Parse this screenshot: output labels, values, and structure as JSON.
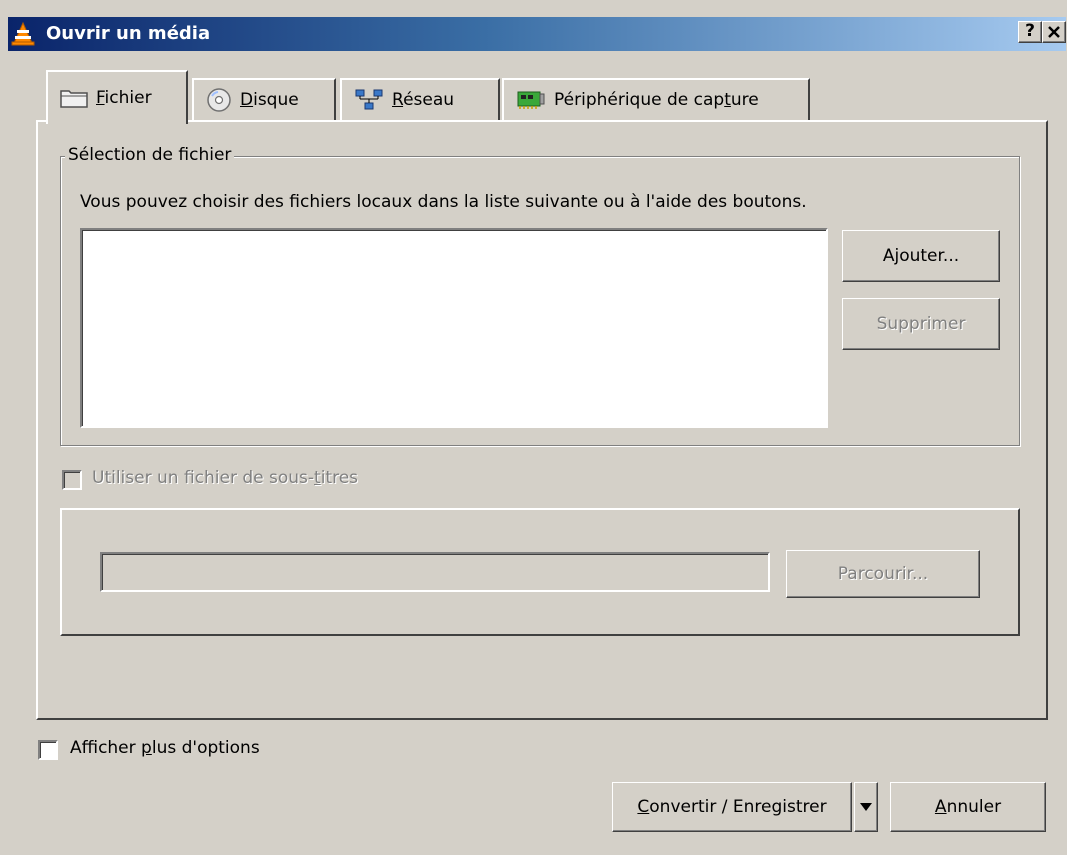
{
  "window": {
    "title": "Ouvrir un média",
    "help_button": "?",
    "close_button": "✕"
  },
  "tabs": [
    {
      "label_underlined": "F",
      "label_rest": "ichier",
      "icon": "folder-icon",
      "active": true
    },
    {
      "label_underlined": "D",
      "label_rest": "isque",
      "icon": "disc-icon",
      "active": false
    },
    {
      "label_underlined": "R",
      "label_rest": "éseau",
      "icon": "network-icon",
      "active": false
    },
    {
      "label_pre": "Périphérique de cap",
      "label_underlined": "t",
      "label_rest": "ure",
      "icon": "capture-card-icon",
      "active": false
    }
  ],
  "file_selection": {
    "group_title": "Sélection de fichier",
    "help_text": "Vous pouvez choisir des fichiers locaux dans la liste suivante ou à l'aide des boutons.",
    "add_button": "Ajouter...",
    "remove_button": "Supprimer",
    "files": []
  },
  "subtitles": {
    "checkbox_label_pre": "Utiliser un fichier de sous-",
    "checkbox_label_underlined": "t",
    "checkbox_label_rest": "itres",
    "checked": false,
    "enabled": false,
    "path_value": "",
    "browse_button": "Parcourir..."
  },
  "more_options": {
    "label_pre": "Afficher ",
    "label_underlined": "p",
    "label_rest": "lus d'options",
    "checked": false
  },
  "footer": {
    "convert_pre": "",
    "convert_underlined": "C",
    "convert_rest": "onvertir / Enregistrer",
    "dropdown_arrow": "▼",
    "cancel_underlined": "A",
    "cancel_rest": "nnuler"
  },
  "colors": {
    "face": "#d4d0c8",
    "title_start": "#0a246a",
    "title_end": "#a6caf0",
    "disabled_text": "#808080",
    "vlc_orange": "#ff8800"
  }
}
